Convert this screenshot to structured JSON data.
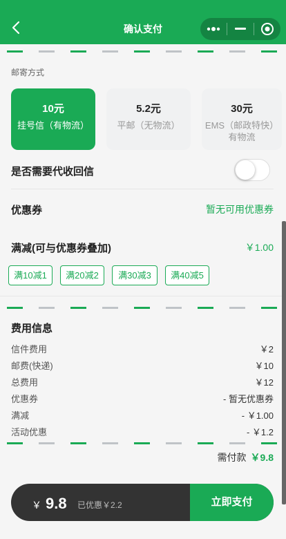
{
  "header": {
    "title": "确认支付"
  },
  "shipping": {
    "label": "邮寄方式",
    "options": [
      {
        "price": "10元",
        "name": "挂号信（有物流）",
        "selected": true
      },
      {
        "price": "5.2元",
        "name": "平邮（无物流）",
        "selected": false
      },
      {
        "price": "30元",
        "name": "EMS（邮政特快）有物流",
        "selected": false
      }
    ]
  },
  "return_letter": {
    "label": "是否需要代收回信",
    "enabled": false
  },
  "coupon": {
    "label": "优惠券",
    "value": "暂无可用优惠券"
  },
  "discount": {
    "label": "满减(可与优惠券叠加)",
    "value": "￥1.00",
    "tags": [
      "满10减1",
      "满20减2",
      "满30减3",
      "满40减5"
    ]
  },
  "fees": {
    "title": "费用信息",
    "rows": [
      {
        "label": "信件费用",
        "value": "￥2"
      },
      {
        "label": "邮费(快递)",
        "value": "￥10"
      },
      {
        "label": "总费用",
        "value": "￥12"
      },
      {
        "label": "优惠券",
        "value": "- 暂无优惠券"
      },
      {
        "label": "满减",
        "value": "- ￥1.00"
      },
      {
        "label": "活动优惠",
        "value": "- ￥1.2"
      }
    ]
  },
  "need_pay": {
    "label": "需付款",
    "value": "￥9.8"
  },
  "paybar": {
    "currency": "￥",
    "amount": "9.8",
    "saved": "已优惠￥2.2",
    "button": "立即支付"
  },
  "colors": {
    "brand": "#1aaa55",
    "dark": "#333333"
  }
}
